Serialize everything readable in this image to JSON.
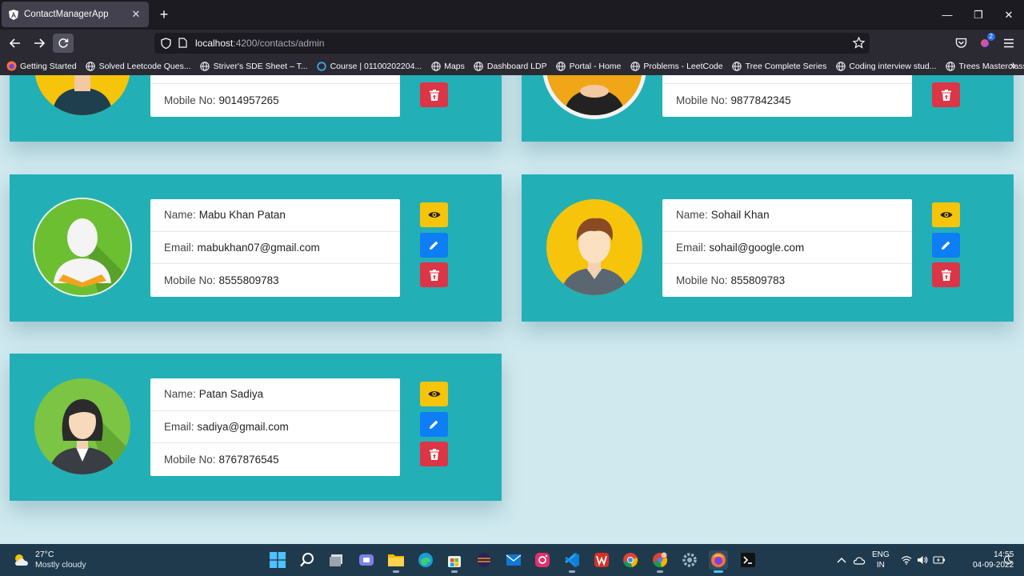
{
  "browser": {
    "tab_title": "ContactManagerApp",
    "url_host": "localhost",
    "url_path": ":4200/contacts/admin",
    "extension_badge": "2",
    "bookmarks": [
      "Getting Started",
      "Solved Leetcode Ques...",
      "Striver's SDE Sheet – T...",
      "Course | 01100202204...",
      "Maps",
      "Dashboard LDP",
      "Portal - Home",
      "Problems - LeetCode",
      "Tree Complete Series",
      "Coding interview stud...",
      "Trees Masterclass In Ja..."
    ]
  },
  "labels": {
    "name": "Name:",
    "email": "Email:",
    "mobile": "Mobile No:"
  },
  "contacts_partial": [
    {
      "mobile": "9014957265"
    },
    {
      "mobile": "9877842345"
    }
  ],
  "contacts": [
    {
      "name": "Mabu Khan Patan",
      "email": "mabukhan07@gmail.com",
      "mobile": "8555809783"
    },
    {
      "name": "Sohail Khan",
      "email": "sohail@google.com",
      "mobile": "855809783"
    },
    {
      "name": "Patan Sadiya",
      "email": "sadiya@gmail.com",
      "mobile": "8767876545"
    }
  ],
  "colors": {
    "card": "#22b0b6",
    "view_button": "#f6c40a",
    "edit_button": "#0d7ef5",
    "delete_button": "#dc3545",
    "page_bg": "#cfe9ef"
  },
  "taskbar": {
    "weather_temp": "27°C",
    "weather_desc": "Mostly cloudy",
    "lang_top": "ENG",
    "lang_bottom": "IN",
    "time": "14:55",
    "date": "04-09-2022"
  }
}
